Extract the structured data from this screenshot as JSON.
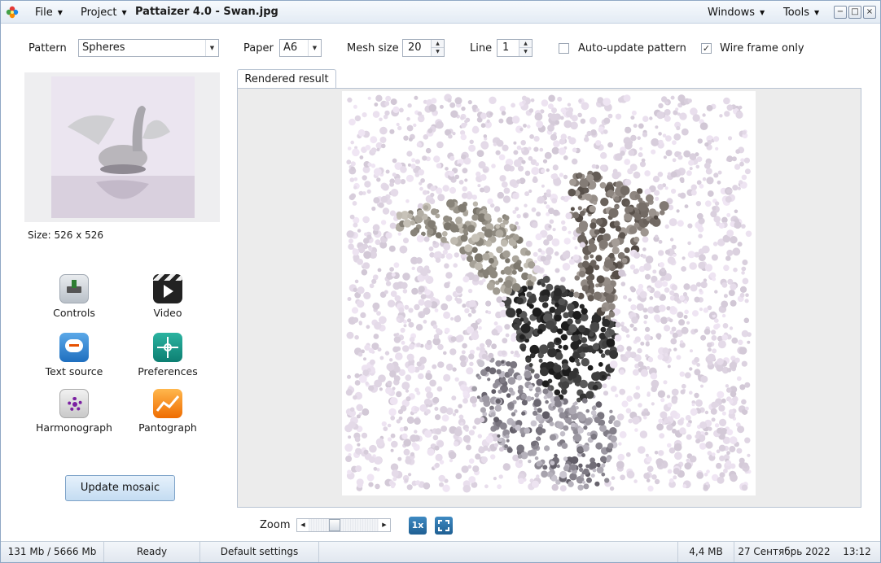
{
  "titlebar": {
    "app_icon": "flower-icon",
    "menu_file": "File",
    "menu_project": "Project",
    "title": "Pattaizer 4.0 - Swan.jpg",
    "menu_windows": "Windows",
    "menu_tools": "Tools",
    "btn_minimize": "−",
    "btn_maximize": "□",
    "btn_close": "×"
  },
  "toolbar": {
    "pattern_label": "Pattern",
    "pattern_value": "Spheres",
    "paper_label": "Paper",
    "paper_value": "A6",
    "mesh_label": "Mesh size",
    "mesh_value": "20",
    "line_label": "Line",
    "line_value": "1",
    "auto_update_label": "Auto-update pattern",
    "auto_update_checked": false,
    "wire_frame_label": "Wire frame only",
    "wire_frame_checked": true
  },
  "left_panel": {
    "source_image": "swan-photo",
    "size_label": "Size: 526 x 526",
    "tools": [
      {
        "label": "Controls",
        "icon": "controls-icon"
      },
      {
        "label": "Video",
        "icon": "clapperboard-icon"
      },
      {
        "label": "Text source",
        "icon": "speech-bubble-icon"
      },
      {
        "label": "Preferences",
        "icon": "preferences-icon"
      },
      {
        "label": "Harmonograph",
        "icon": "gear-icon"
      },
      {
        "label": "Pantograph",
        "icon": "line-graph-icon"
      }
    ],
    "update_button": "Update mosaic"
  },
  "result": {
    "tab_label": "Rendered result",
    "content": "sphere-mosaic-of-swan"
  },
  "zoom": {
    "label": "Zoom",
    "btn_1x": "1x",
    "btn_fit": "fit-icon"
  },
  "status": {
    "memory": "131 Mb / 5666 Mb",
    "state": "Ready",
    "settings": "Default settings",
    "file_size": "4,4 MB",
    "date": "27 Сентябрь 2022",
    "time": "13:12"
  },
  "colors": {
    "titlebar": "#e9eff6",
    "button_accent": "#c4dcf2",
    "zoom_buttons": "#2f74ab",
    "canvas_bg": "#ffffff",
    "dot_light": "#dcd4e0",
    "dot_dark": "#1e1e1e"
  }
}
